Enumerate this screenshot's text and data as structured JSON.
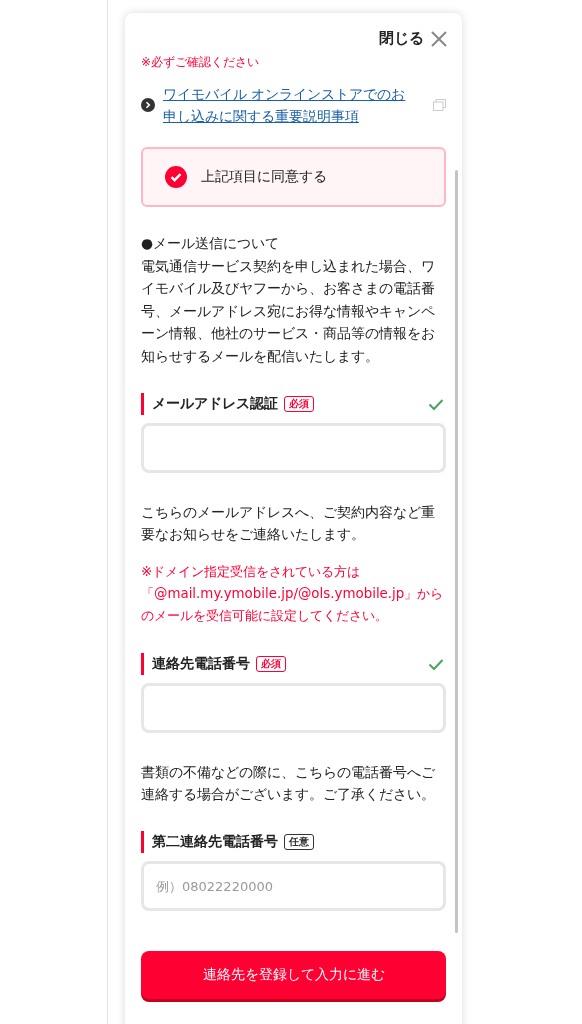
{
  "dialog": {
    "close_label": "閉じる",
    "notice": "※必ずご確認ください",
    "link": {
      "text": "ワイモバイル オンラインストアでのお申し込みに関する重要説明事項"
    },
    "agree": {
      "label": "上記項目に同意する",
      "checked": true
    },
    "mail_info": {
      "heading": "●メール送信について",
      "body": "電気通信サービス契約を申し込まれた場合、ワイモバイル及びヤフーから、お客さまの電話番号、メールアドレス宛にお得な情報やキャンペーン情報、他社のサービス・商品等の情報をお知らせするメールを配信いたします。"
    },
    "fields": [
      {
        "label": "メールアドレス認証",
        "badge": "必須",
        "kind": "required",
        "valid": true,
        "notes": [
          {
            "kind": "normal",
            "text": "こちらのメールアドレスへ、ご契約内容など重要なお知らせをご連絡いたします。"
          },
          {
            "kind": "warning",
            "text": "※ドメイン指定受信をされている方は「@mail.my.ymobile.jp/@ols.ymobile.jp」からのメールを受信可能に設定してください。"
          }
        ]
      },
      {
        "label": "連絡先電話番号",
        "badge": "必須",
        "kind": "required",
        "valid": true,
        "notes": [
          {
            "kind": "normal",
            "text": "書類の不備などの際に、こちらの電話番号へご連絡する場合がございます。ご了承ください。"
          }
        ]
      },
      {
        "label": "第二連絡先電話番号",
        "badge": "任意",
        "kind": "optional",
        "valid": false,
        "placeholder": "例）08022220000"
      }
    ],
    "submit": "連絡先を登録して入力に進む"
  }
}
